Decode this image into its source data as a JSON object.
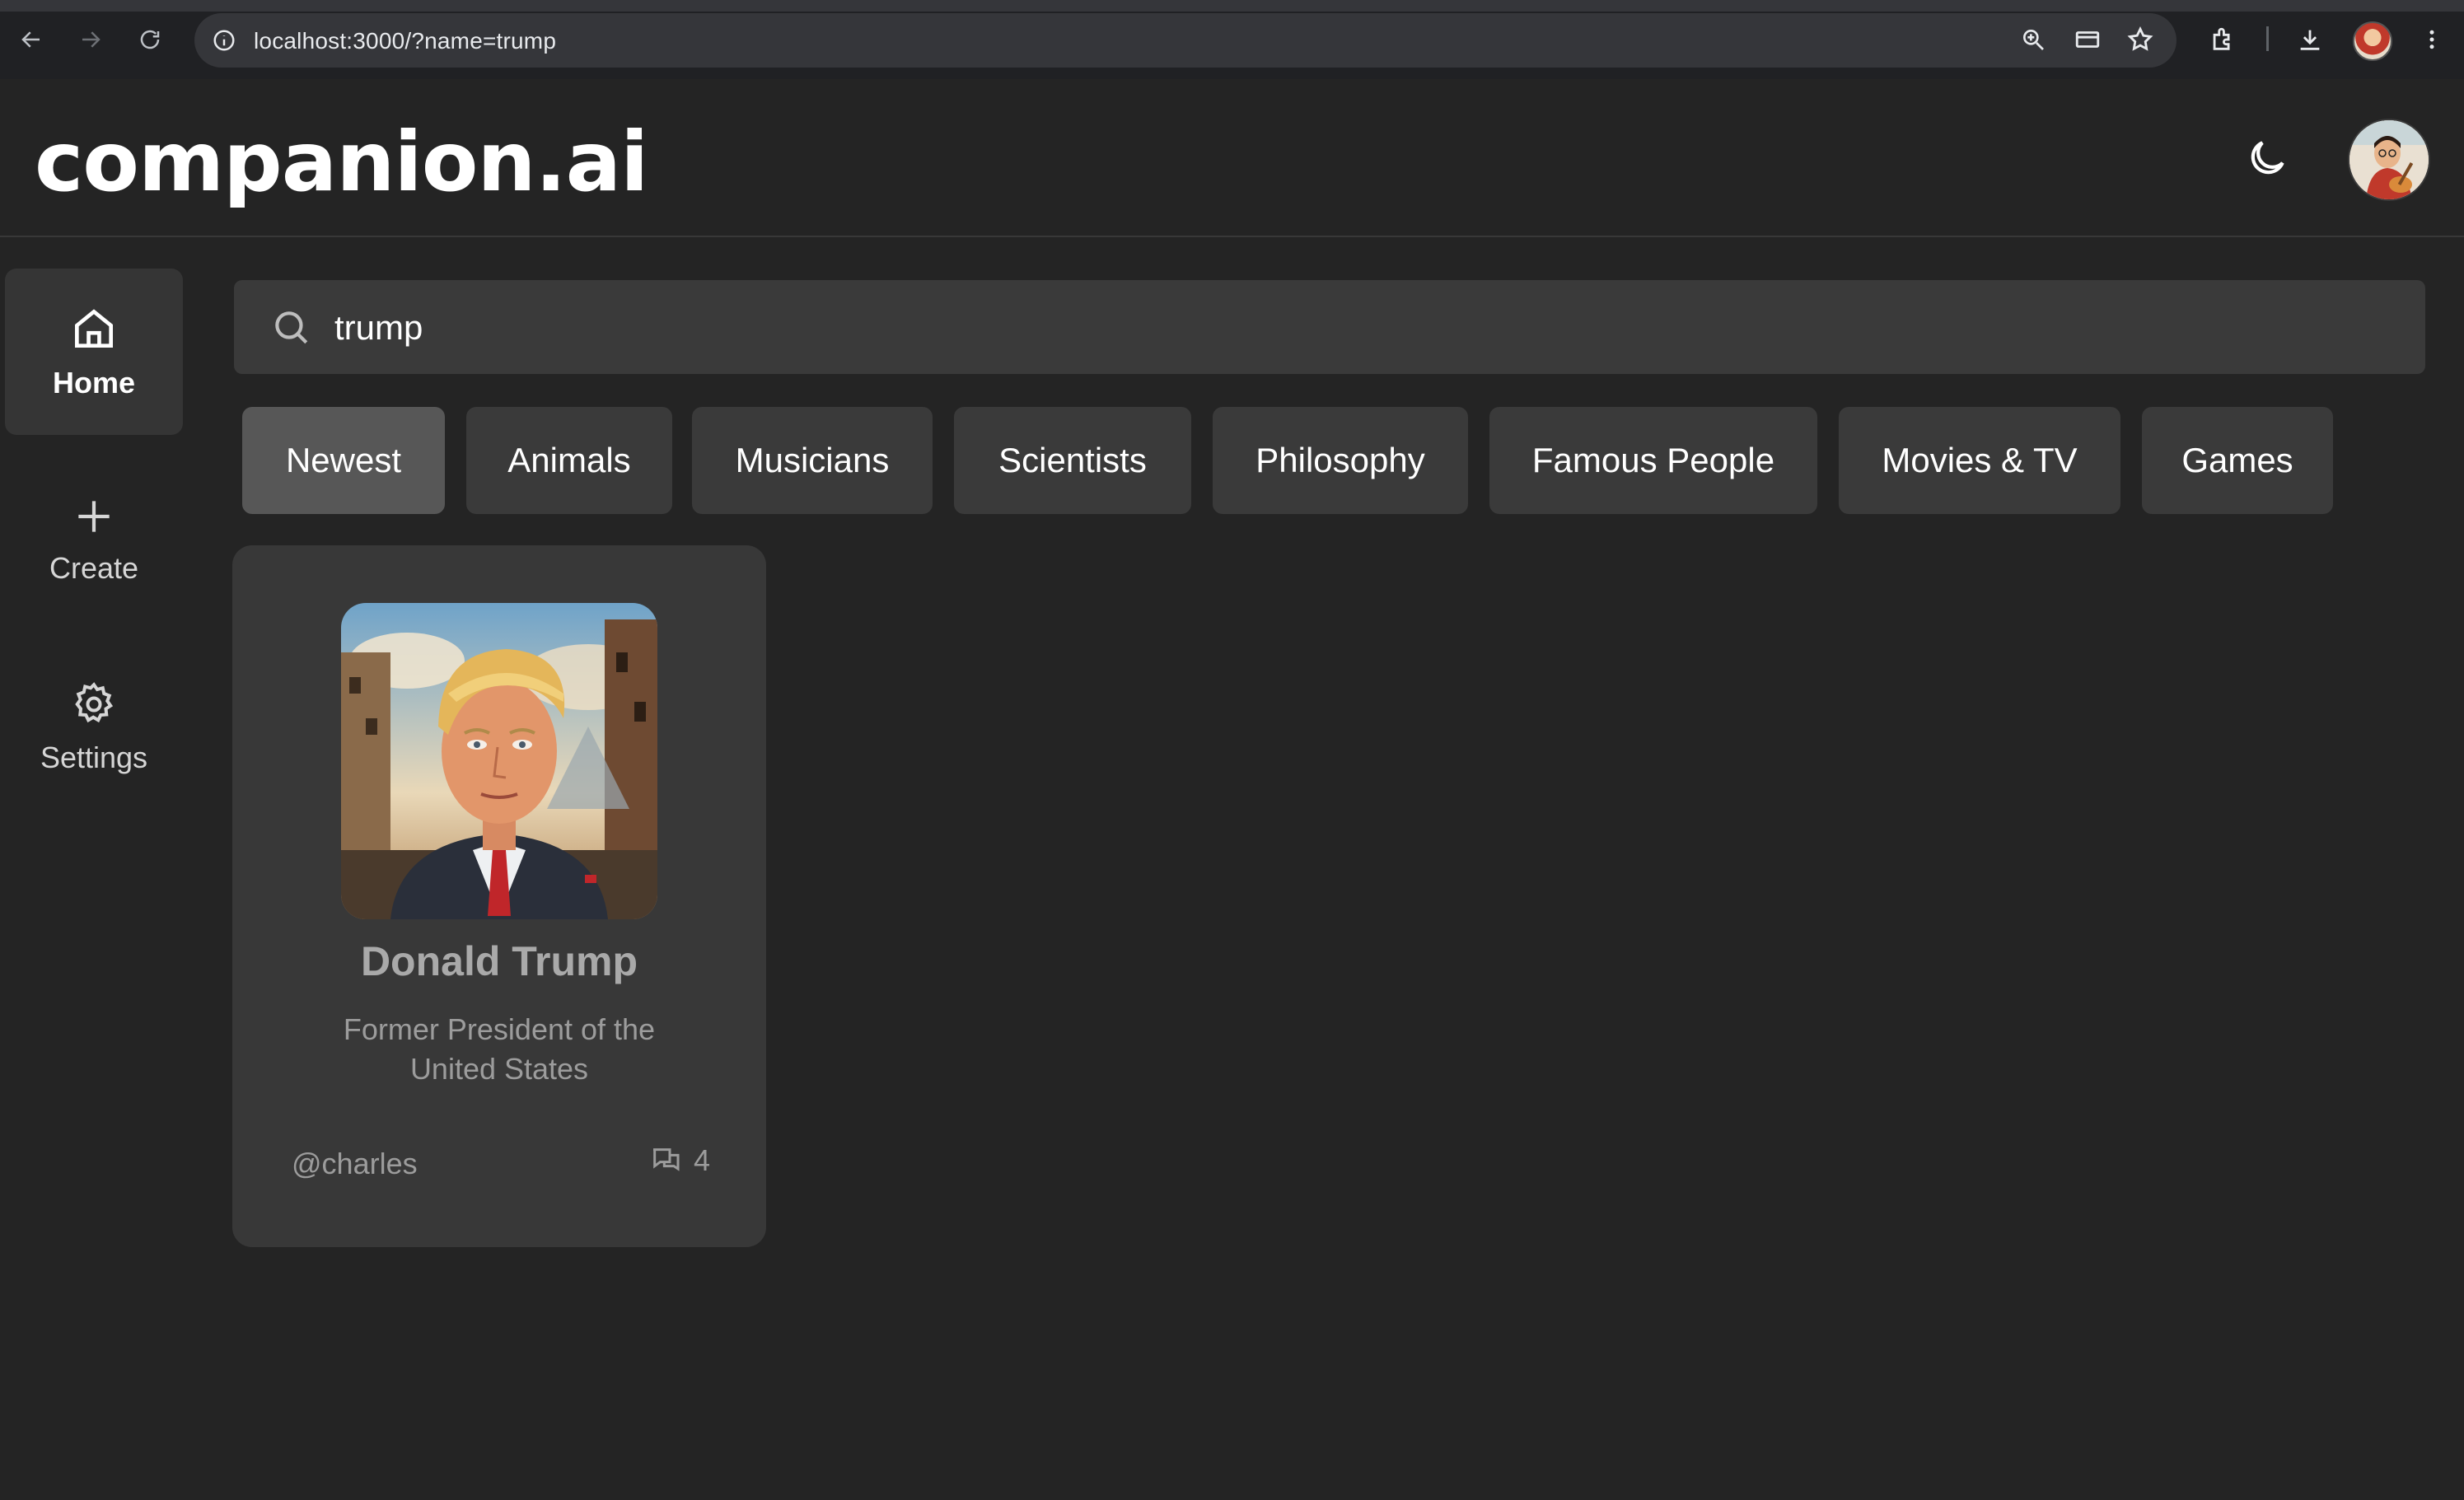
{
  "browser": {
    "url": "localhost:3000/?name=trump"
  },
  "app": {
    "brand": "companion.ai"
  },
  "sidebar": {
    "items": [
      {
        "label": "Home",
        "icon": "home-icon",
        "active": true
      },
      {
        "label": "Create",
        "icon": "plus-icon",
        "active": false
      },
      {
        "label": "Settings",
        "icon": "gear-icon",
        "active": false
      }
    ]
  },
  "search": {
    "value": "trump"
  },
  "categories": [
    {
      "label": "Newest",
      "active": true
    },
    {
      "label": "Animals",
      "active": false
    },
    {
      "label": "Musicians",
      "active": false
    },
    {
      "label": "Scientists",
      "active": false
    },
    {
      "label": "Philosophy",
      "active": false
    },
    {
      "label": "Famous People",
      "active": false
    },
    {
      "label": "Movies & TV",
      "active": false
    },
    {
      "label": "Games",
      "active": false
    }
  ],
  "companions": [
    {
      "name": "Donald Trump",
      "description": "Former President of the United States",
      "user": "@charles",
      "message_count": "4"
    }
  ],
  "colors": {
    "background": "#242424",
    "surface": "#383838",
    "chip": "#3a3a3a",
    "chip_active": "#575757"
  }
}
